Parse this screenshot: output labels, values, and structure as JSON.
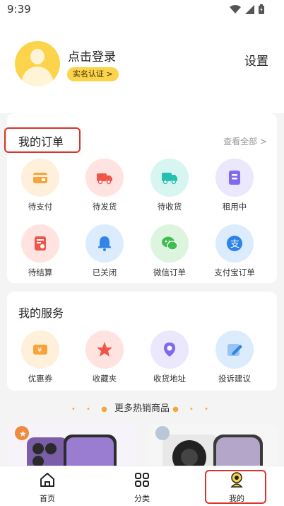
{
  "status_bar": {
    "time": "9:39"
  },
  "header": {
    "login_label": "点击登录",
    "verify_label": "实名认证 >",
    "settings_label": "设置"
  },
  "orders": {
    "title": "我的订单",
    "view_all": "查看全部 >",
    "items": [
      {
        "label": "待支付",
        "icon": "wallet-icon",
        "color": "#f7a33b",
        "bg": "#fff0dc"
      },
      {
        "label": "待发货",
        "icon": "truck-icon",
        "color": "#f0554a",
        "bg": "#ffe3e1"
      },
      {
        "label": "待收货",
        "icon": "delivery-truck-icon",
        "color": "#24c2ae",
        "bg": "#d8f6f1"
      },
      {
        "label": "租用中",
        "icon": "document-icon",
        "color": "#7d6af0",
        "bg": "#ebe7fd"
      },
      {
        "label": "待结算",
        "icon": "bill-icon",
        "color": "#f0554a",
        "bg": "#ffe3e1"
      },
      {
        "label": "已关闭",
        "icon": "bell-icon",
        "color": "#2f86e8",
        "bg": "#dcecfd"
      },
      {
        "label": "微信订单",
        "icon": "wechat-icon",
        "color": "#3fbf50",
        "bg": "#ddf5df"
      },
      {
        "label": "支付宝订单",
        "icon": "alipay-icon",
        "color": "#2d84e8",
        "bg": "#dcecfd"
      }
    ]
  },
  "services": {
    "title": "我的服务",
    "items": [
      {
        "label": "优惠券",
        "icon": "coupon-icon",
        "color": "#f7a33b",
        "bg": "#fff0dc"
      },
      {
        "label": "收藏夹",
        "icon": "star-icon",
        "color": "#f0554a",
        "bg": "#ffe3e1"
      },
      {
        "label": "收货地址",
        "icon": "location-icon",
        "color": "#7d6af0",
        "bg": "#ebe7fd"
      },
      {
        "label": "投诉建议",
        "icon": "edit-icon",
        "color": "#2f86e8",
        "bg": "#dcecfd"
      }
    ]
  },
  "more": {
    "label": "更多热销商品"
  },
  "tabbar": {
    "items": [
      {
        "label": "首页",
        "icon": "home-icon"
      },
      {
        "label": "分类",
        "icon": "category-icon"
      },
      {
        "label": "我的",
        "icon": "profile-icon"
      }
    ]
  },
  "colors": {
    "accent": "#fbd44c",
    "highlight": "#d9342b"
  }
}
